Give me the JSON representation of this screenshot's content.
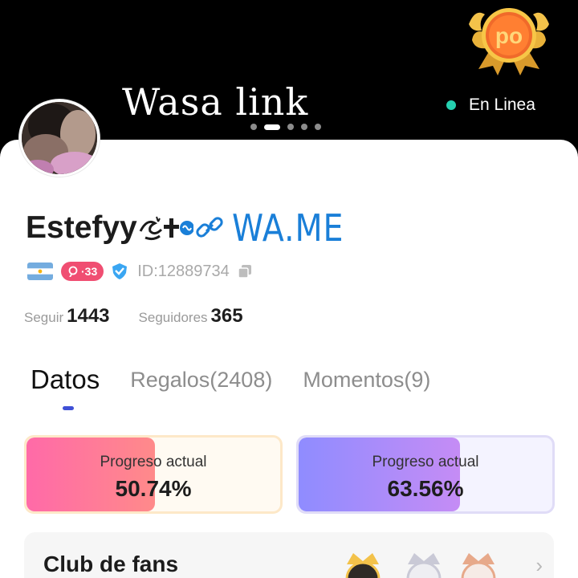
{
  "header": {
    "banner_title": "Wasa link",
    "status_text": "En Linea",
    "medal_text": "po",
    "carousel_total": 5,
    "carousel_active": 2
  },
  "profile": {
    "name": "Estefyy",
    "link_text": "WA.ME",
    "level_badge": "33",
    "user_id": "ID:12889734",
    "following_label": "Seguir",
    "following_count": "1443",
    "followers_label": "Seguidores",
    "followers_count": "365"
  },
  "tabs": [
    {
      "label": "Datos",
      "active": true
    },
    {
      "label": "Regalos(2408)",
      "active": false
    },
    {
      "label": "Momentos(9)",
      "active": false
    }
  ],
  "progress": [
    {
      "label": "Progreso actual",
      "value": "50.74%",
      "fraction": 0.5074
    },
    {
      "label": "Progreso actual",
      "value": "63.56%",
      "fraction": 0.6356
    }
  ],
  "fans_club": {
    "title": "Club de fans"
  },
  "colors": {
    "status_online": "#25d0b0",
    "link": "#1a7fd8",
    "level_badge": "#f04e72",
    "tab_indicator": "#3f50d6"
  },
  "icons": {
    "medal": "gold-medal-icon",
    "link": "link-chain-icon",
    "flag": "argentina-flag-icon",
    "level": "level-heart-icon",
    "verified": "verified-shield-icon",
    "copy": "copy-icon"
  }
}
